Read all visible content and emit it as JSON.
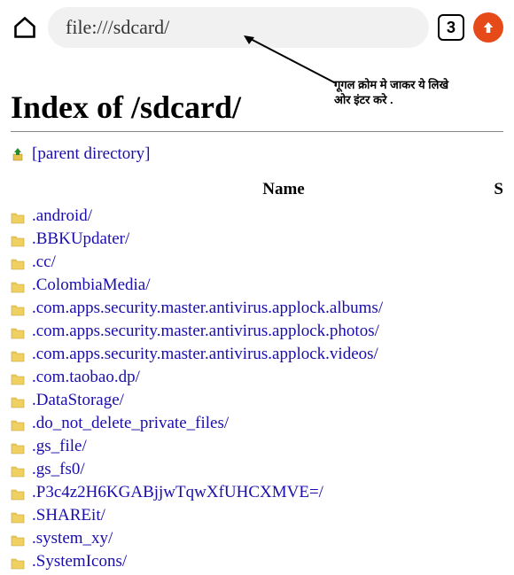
{
  "address_bar": {
    "url": "file:///sdcard/"
  },
  "tab_count": "3",
  "annotation": {
    "line1": "गूगल क्रोम मे जाकर ये लिखे",
    "line2": "ओर इंटर करे ."
  },
  "page_title": "Index of /sdcard/",
  "parent_link": "[parent directory]",
  "columns": {
    "name": "Name",
    "size": "S"
  },
  "entries": [
    ".android/",
    ".BBKUpdater/",
    ".cc/",
    ".ColombiaMedia/",
    ".com.apps.security.master.antivirus.applock.albums/",
    ".com.apps.security.master.antivirus.applock.photos/",
    ".com.apps.security.master.antivirus.applock.videos/",
    ".com.taobao.dp/",
    ".DataStorage/",
    ".do_not_delete_private_files/",
    ".gs_file/",
    ".gs_fs0/",
    ".P3c4z2H6KGABjjwTqwXfUHCXMVE=/",
    ".SHAREit/",
    ".system_xy/",
    ".SystemIcons/"
  ]
}
